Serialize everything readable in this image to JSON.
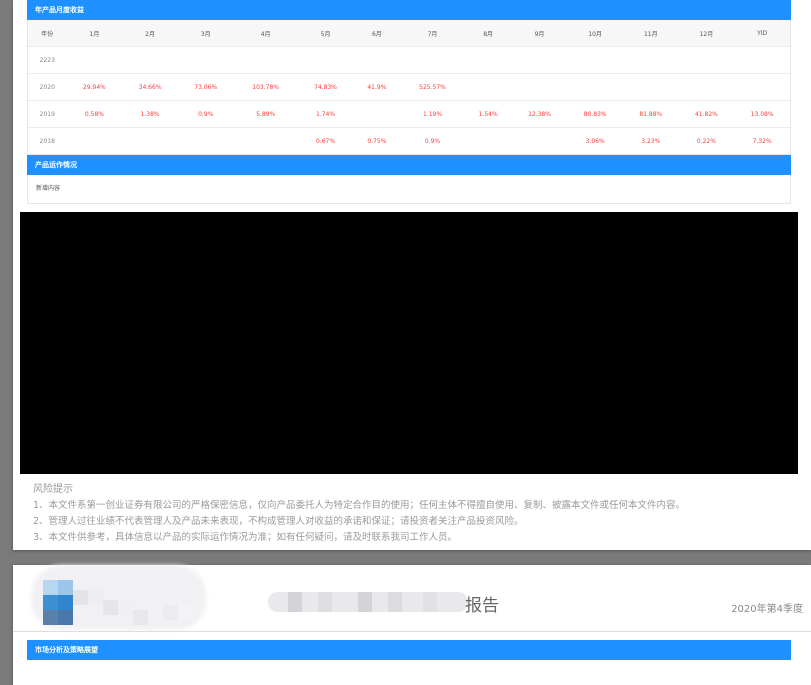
{
  "monthly_returns": {
    "title": "年产品月度收益",
    "headers": [
      "年份",
      "1月",
      "2月",
      "3月",
      "4月",
      "5月",
      "6月",
      "7月",
      "8月",
      "9月",
      "10月",
      "11月",
      "12月",
      "YID"
    ],
    "rows": [
      [
        "2223",
        "",
        "",
        "",
        "",
        "",
        "",
        "",
        "",
        "",
        "",
        "",
        "",
        " "
      ],
      [
        "2020",
        "29.94%",
        "34.66%",
        "73.06%",
        "103.78%",
        "74.83%",
        "41.9%",
        "525.57%",
        "",
        "",
        "",
        "",
        "",
        ""
      ],
      [
        "2019",
        "0.58%",
        "1.38%",
        "0.9%",
        "5.89%",
        "1.74%",
        "",
        "1.19%",
        "1.54%",
        "12.38%",
        "80.83%",
        "81.88%",
        "41.82%",
        "13.08%"
      ],
      [
        "2018",
        "",
        "",
        "",
        "",
        "0.67%",
        "0.75%",
        "0.9%",
        "",
        "",
        "3.06%",
        "3.23%",
        "0.22%",
        "7.32%"
      ]
    ]
  },
  "operations": {
    "title": "产品运作情况",
    "content": "新增内容"
  },
  "risk": {
    "title": "风险提示",
    "items": [
      "1、本文件系第一创业证券有限公司的严格保密信息，仅向产品委托人为特定合作目的使用；任何主体不得擅自使用、复制、披露本文件或任何本文件内容。",
      "2、管理人过往业绩不代表管理人及产品未来表现，不构成管理人对收益的承诺和保证；请投资者关注产品投资风险。",
      "3、本文件供参考，具体信息以产品的实际运作情况为准；如有任何疑问，请及时联系我司工作人员。"
    ]
  },
  "page2": {
    "report_word": "报告",
    "quarter": "2020年第4季度",
    "section_title": "市场分析及策略展望"
  }
}
